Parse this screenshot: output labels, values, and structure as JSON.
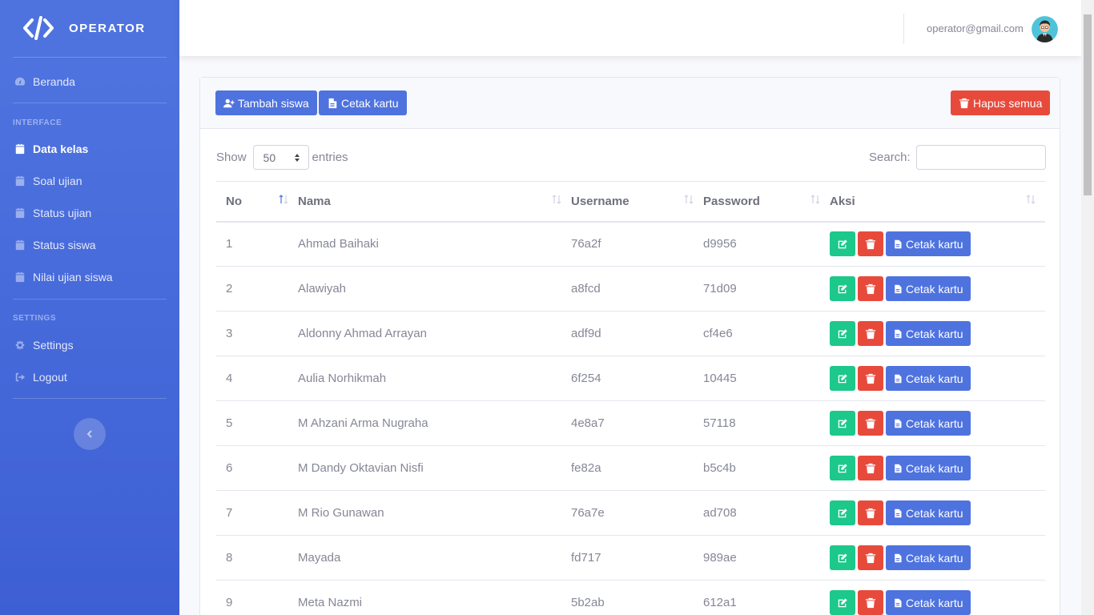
{
  "brand": {
    "name": "OPERATOR"
  },
  "sidebar": {
    "dashboard": "Beranda",
    "interface_heading": "INTERFACE",
    "items": [
      "Data kelas",
      "Soal ujian",
      "Status ujian",
      "Status siswa",
      "Nilai ujian siswa"
    ],
    "settings_heading": "SETTINGS",
    "settings": "Settings",
    "logout": "Logout"
  },
  "topbar": {
    "user_email": "operator@gmail.com"
  },
  "toolbar": {
    "add_label": "Tambah siswa",
    "print_label": "Cetak kartu",
    "delete_all_label": "Hapus semua"
  },
  "table_controls": {
    "show": "Show",
    "entries_value": "50",
    "entries": "entries",
    "search": "Search:"
  },
  "table": {
    "columns": [
      "No",
      "Nama",
      "Username",
      "Password",
      "Aksi"
    ],
    "print_label": "Cetak kartu",
    "rows": [
      {
        "no": "1",
        "nama": "Ahmad Baihaki",
        "username": "76a2f",
        "password": "d9956"
      },
      {
        "no": "2",
        "nama": "Alawiyah",
        "username": "a8fcd",
        "password": "71d09"
      },
      {
        "no": "3",
        "nama": "Aldonny Ahmad Arrayan",
        "username": "adf9d",
        "password": "cf4e6"
      },
      {
        "no": "4",
        "nama": "Aulia Norhikmah",
        "username": "6f254",
        "password": "10445"
      },
      {
        "no": "5",
        "nama": "M Ahzani Arma Nugraha",
        "username": "4e8a7",
        "password": "57118"
      },
      {
        "no": "6",
        "nama": "M Dandy Oktavian Nisfi",
        "username": "fe82a",
        "password": "b5c4b"
      },
      {
        "no": "7",
        "nama": "M Rio Gunawan",
        "username": "76a7e",
        "password": "ad708"
      },
      {
        "no": "8",
        "nama": "Mayada",
        "username": "fd717",
        "password": "989ae"
      },
      {
        "no": "9",
        "nama": "Meta Nazmi",
        "username": "5b2ab",
        "password": "612a1"
      }
    ]
  },
  "icons": {
    "logo": "code-icon",
    "dashboard": "tachometer-icon",
    "calendar": "calendar-icon",
    "settings": "gear-icon",
    "logout": "sign-out-icon",
    "add": "user-plus-icon",
    "pdf": "file-pdf-icon",
    "trash": "trash-icon",
    "edit": "edit-icon",
    "collapse": "chevron-left-icon"
  },
  "colors": {
    "primary": "#4e73df",
    "danger": "#e74a3b",
    "success": "#1cc88a"
  }
}
